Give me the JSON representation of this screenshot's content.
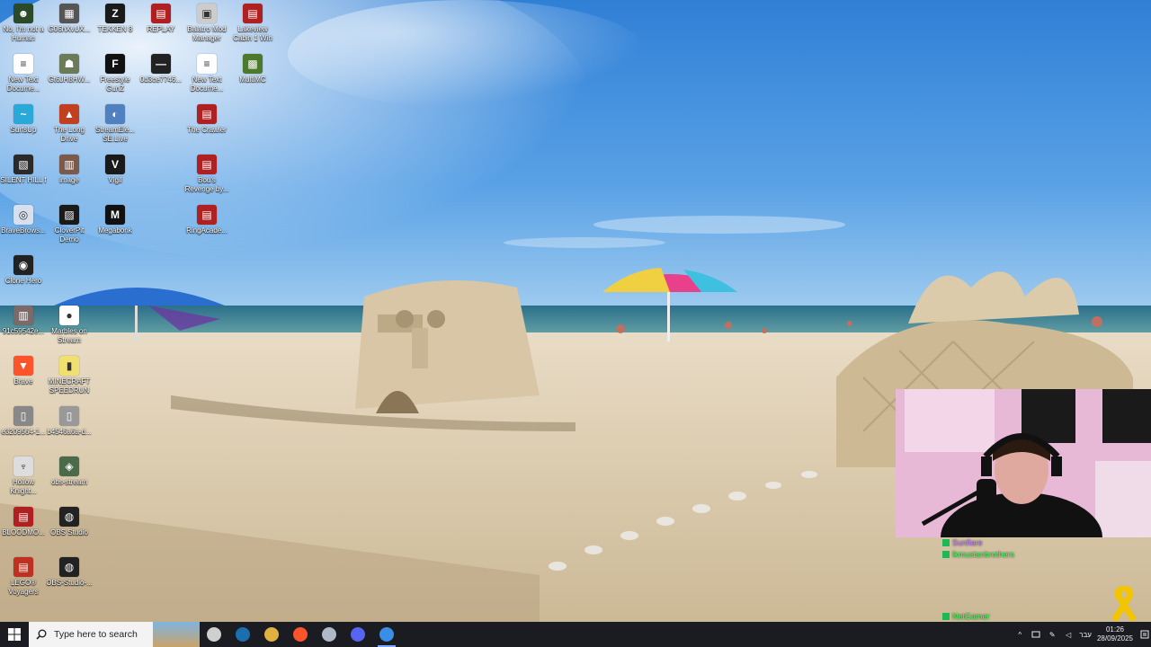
{
  "desktop": {
    "icons": [
      {
        "label": "No, I'm not a Human",
        "color": "#2a4a2a",
        "glyph": "☻"
      },
      {
        "label": "G06hXvUX...",
        "color": "#555555",
        "glyph": "▦"
      },
      {
        "label": "TEKKEN 8",
        "color": "#1a1a1a",
        "glyph": "Z"
      },
      {
        "label": "REPLAY",
        "color": "#b02020",
        "glyph": "▤"
      },
      {
        "label": "Balatro Mod Manager",
        "color": "#cccccc",
        "glyph": "▣"
      },
      {
        "label": "Lakeview Cabin 1 Win",
        "color": "#b02020",
        "glyph": "▤"
      },
      {
        "label": "New Text Docume...",
        "color": "#ffffff",
        "glyph": "≡"
      },
      {
        "label": "Gt6JH8HW...",
        "color": "#6b7b5a",
        "glyph": "☗"
      },
      {
        "label": "Freestyle GunZ",
        "color": "#111111",
        "glyph": "F"
      },
      {
        "label": "0d3ce7746...",
        "color": "#222222",
        "glyph": "—"
      },
      {
        "label": "New Text Docume...",
        "color": "#ffffff",
        "glyph": "≡"
      },
      {
        "label": "MultiMC",
        "color": "#4d7a2a",
        "glyph": "▩"
      },
      {
        "label": "SurfsUp",
        "color": "#2aa8d8",
        "glyph": "~"
      },
      {
        "label": "The Long Drive",
        "color": "#c04020",
        "glyph": "▲"
      },
      {
        "label": "StreamEle... SE.Live",
        "color": "#5080c0",
        "glyph": "◐"
      },
      {
        "label": "The Crawler",
        "color": "#b02020",
        "glyph": "▤"
      },
      {
        "label": "SILENT HILL f",
        "color": "#2a2a2a",
        "glyph": "▧"
      },
      {
        "label": "image",
        "color": "#7a5a4a",
        "glyph": "▥"
      },
      {
        "label": "Vigil",
        "color": "#1a1a1a",
        "glyph": "V"
      },
      {
        "label": "Bou's Revenge by...",
        "color": "#b02020",
        "glyph": "▤"
      },
      {
        "label": "BraveBrows...",
        "color": "#d8e0f0",
        "glyph": "◎"
      },
      {
        "label": "CloverPit Demo",
        "color": "#1a1a1a",
        "glyph": "▨"
      },
      {
        "label": "Megabonk",
        "color": "#111111",
        "glyph": "M"
      },
      {
        "label": "RingAcade...",
        "color": "#b02020",
        "glyph": "▤"
      },
      {
        "label": "Clone Hero",
        "color": "#222222",
        "glyph": "◉"
      },
      {
        "label": "91c59542e...",
        "color": "#7a6a6a",
        "glyph": "▥"
      },
      {
        "label": "Marbles on Stream",
        "color": "#ffffff",
        "glyph": "●"
      },
      {
        "label": "Brave",
        "color": "#fb542b",
        "glyph": "▼"
      },
      {
        "label": "MINECRAFT SPEEDRUN",
        "color": "#f0e070",
        "glyph": "▮"
      },
      {
        "label": "e3209564-1...",
        "color": "#888888",
        "glyph": "▯"
      },
      {
        "label": "b4546a6a-d...",
        "color": "#999999",
        "glyph": "▯"
      },
      {
        "label": "Hollow Knight...",
        "color": "#dddddd",
        "glyph": "♆"
      },
      {
        "label": "obs-stream",
        "color": "#4a6a4a",
        "glyph": "◈"
      },
      {
        "label": "BLOODMO...",
        "color": "#b02020",
        "glyph": "▤"
      },
      {
        "label": "OBS Studio",
        "color": "#222222",
        "glyph": "◍"
      },
      {
        "label": "LEGO® Voyagers",
        "color": "#c03020",
        "glyph": "▤"
      },
      {
        "label": "OBS-Studio-...",
        "color": "#222222",
        "glyph": "◍"
      }
    ]
  },
  "chat": {
    "lines": [
      {
        "user": "Sunflare",
        "text": "",
        "color": "#c080ff"
      },
      {
        "user": "lkmustanbrothers",
        "text": "",
        "color": "#3cff5a"
      },
      {
        "user": "",
        "text": "",
        "color": "#dddddd"
      },
      {
        "user": "",
        "text": "",
        "color": "#dddddd"
      },
      {
        "user": "NetGamer",
        "text": "",
        "color": "#3cff5a"
      }
    ]
  },
  "taskbar": {
    "search_placeholder": "Type here to search",
    "apps": [
      {
        "name": "obs-icon",
        "color": "#cfcfcf",
        "active": false
      },
      {
        "name": "steam-icon",
        "color": "#1b6fae",
        "active": false
      },
      {
        "name": "file-explorer-icon",
        "color": "#e0b040",
        "active": false
      },
      {
        "name": "brave-icon",
        "color": "#fb542b",
        "active": false
      },
      {
        "name": "shield-app-icon",
        "color": "#b0b8c8",
        "active": false
      },
      {
        "name": "discord-icon",
        "color": "#5865f2",
        "active": false
      },
      {
        "name": "vscode-icon",
        "color": "#3a8ee6",
        "active": true
      }
    ],
    "tray": {
      "language": "עבר",
      "time": "01:26",
      "date": "28/09/2025"
    }
  }
}
